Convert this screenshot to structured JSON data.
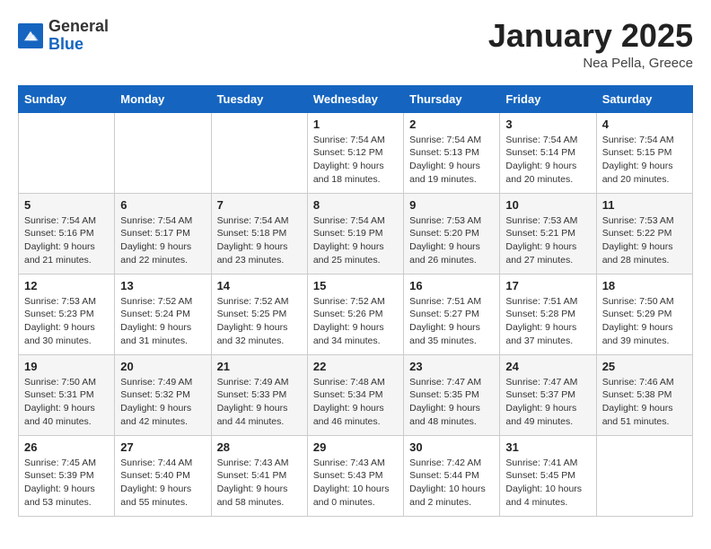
{
  "logo": {
    "general": "General",
    "blue": "Blue"
  },
  "title": "January 2025",
  "location": "Nea Pella, Greece",
  "days_header": [
    "Sunday",
    "Monday",
    "Tuesday",
    "Wednesday",
    "Thursday",
    "Friday",
    "Saturday"
  ],
  "weeks": [
    [
      {
        "num": "",
        "info": ""
      },
      {
        "num": "",
        "info": ""
      },
      {
        "num": "",
        "info": ""
      },
      {
        "num": "1",
        "sunrise": "7:54 AM",
        "sunset": "5:12 PM",
        "daylight": "9 hours and 18 minutes."
      },
      {
        "num": "2",
        "sunrise": "7:54 AM",
        "sunset": "5:13 PM",
        "daylight": "9 hours and 19 minutes."
      },
      {
        "num": "3",
        "sunrise": "7:54 AM",
        "sunset": "5:14 PM",
        "daylight": "9 hours and 20 minutes."
      },
      {
        "num": "4",
        "sunrise": "7:54 AM",
        "sunset": "5:15 PM",
        "daylight": "9 hours and 20 minutes."
      }
    ],
    [
      {
        "num": "5",
        "sunrise": "7:54 AM",
        "sunset": "5:16 PM",
        "daylight": "9 hours and 21 minutes."
      },
      {
        "num": "6",
        "sunrise": "7:54 AM",
        "sunset": "5:17 PM",
        "daylight": "9 hours and 22 minutes."
      },
      {
        "num": "7",
        "sunrise": "7:54 AM",
        "sunset": "5:18 PM",
        "daylight": "9 hours and 23 minutes."
      },
      {
        "num": "8",
        "sunrise": "7:54 AM",
        "sunset": "5:19 PM",
        "daylight": "9 hours and 25 minutes."
      },
      {
        "num": "9",
        "sunrise": "7:53 AM",
        "sunset": "5:20 PM",
        "daylight": "9 hours and 26 minutes."
      },
      {
        "num": "10",
        "sunrise": "7:53 AM",
        "sunset": "5:21 PM",
        "daylight": "9 hours and 27 minutes."
      },
      {
        "num": "11",
        "sunrise": "7:53 AM",
        "sunset": "5:22 PM",
        "daylight": "9 hours and 28 minutes."
      }
    ],
    [
      {
        "num": "12",
        "sunrise": "7:53 AM",
        "sunset": "5:23 PM",
        "daylight": "9 hours and 30 minutes."
      },
      {
        "num": "13",
        "sunrise": "7:52 AM",
        "sunset": "5:24 PM",
        "daylight": "9 hours and 31 minutes."
      },
      {
        "num": "14",
        "sunrise": "7:52 AM",
        "sunset": "5:25 PM",
        "daylight": "9 hours and 32 minutes."
      },
      {
        "num": "15",
        "sunrise": "7:52 AM",
        "sunset": "5:26 PM",
        "daylight": "9 hours and 34 minutes."
      },
      {
        "num": "16",
        "sunrise": "7:51 AM",
        "sunset": "5:27 PM",
        "daylight": "9 hours and 35 minutes."
      },
      {
        "num": "17",
        "sunrise": "7:51 AM",
        "sunset": "5:28 PM",
        "daylight": "9 hours and 37 minutes."
      },
      {
        "num": "18",
        "sunrise": "7:50 AM",
        "sunset": "5:29 PM",
        "daylight": "9 hours and 39 minutes."
      }
    ],
    [
      {
        "num": "19",
        "sunrise": "7:50 AM",
        "sunset": "5:31 PM",
        "daylight": "9 hours and 40 minutes."
      },
      {
        "num": "20",
        "sunrise": "7:49 AM",
        "sunset": "5:32 PM",
        "daylight": "9 hours and 42 minutes."
      },
      {
        "num": "21",
        "sunrise": "7:49 AM",
        "sunset": "5:33 PM",
        "daylight": "9 hours and 44 minutes."
      },
      {
        "num": "22",
        "sunrise": "7:48 AM",
        "sunset": "5:34 PM",
        "daylight": "9 hours and 46 minutes."
      },
      {
        "num": "23",
        "sunrise": "7:47 AM",
        "sunset": "5:35 PM",
        "daylight": "9 hours and 48 minutes."
      },
      {
        "num": "24",
        "sunrise": "7:47 AM",
        "sunset": "5:37 PM",
        "daylight": "9 hours and 49 minutes."
      },
      {
        "num": "25",
        "sunrise": "7:46 AM",
        "sunset": "5:38 PM",
        "daylight": "9 hours and 51 minutes."
      }
    ],
    [
      {
        "num": "26",
        "sunrise": "7:45 AM",
        "sunset": "5:39 PM",
        "daylight": "9 hours and 53 minutes."
      },
      {
        "num": "27",
        "sunrise": "7:44 AM",
        "sunset": "5:40 PM",
        "daylight": "9 hours and 55 minutes."
      },
      {
        "num": "28",
        "sunrise": "7:43 AM",
        "sunset": "5:41 PM",
        "daylight": "9 hours and 58 minutes."
      },
      {
        "num": "29",
        "sunrise": "7:43 AM",
        "sunset": "5:43 PM",
        "daylight": "10 hours and 0 minutes."
      },
      {
        "num": "30",
        "sunrise": "7:42 AM",
        "sunset": "5:44 PM",
        "daylight": "10 hours and 2 minutes."
      },
      {
        "num": "31",
        "sunrise": "7:41 AM",
        "sunset": "5:45 PM",
        "daylight": "10 hours and 4 minutes."
      },
      {
        "num": "",
        "info": ""
      }
    ]
  ],
  "labels": {
    "sunrise": "Sunrise:",
    "sunset": "Sunset:",
    "daylight": "Daylight:"
  }
}
